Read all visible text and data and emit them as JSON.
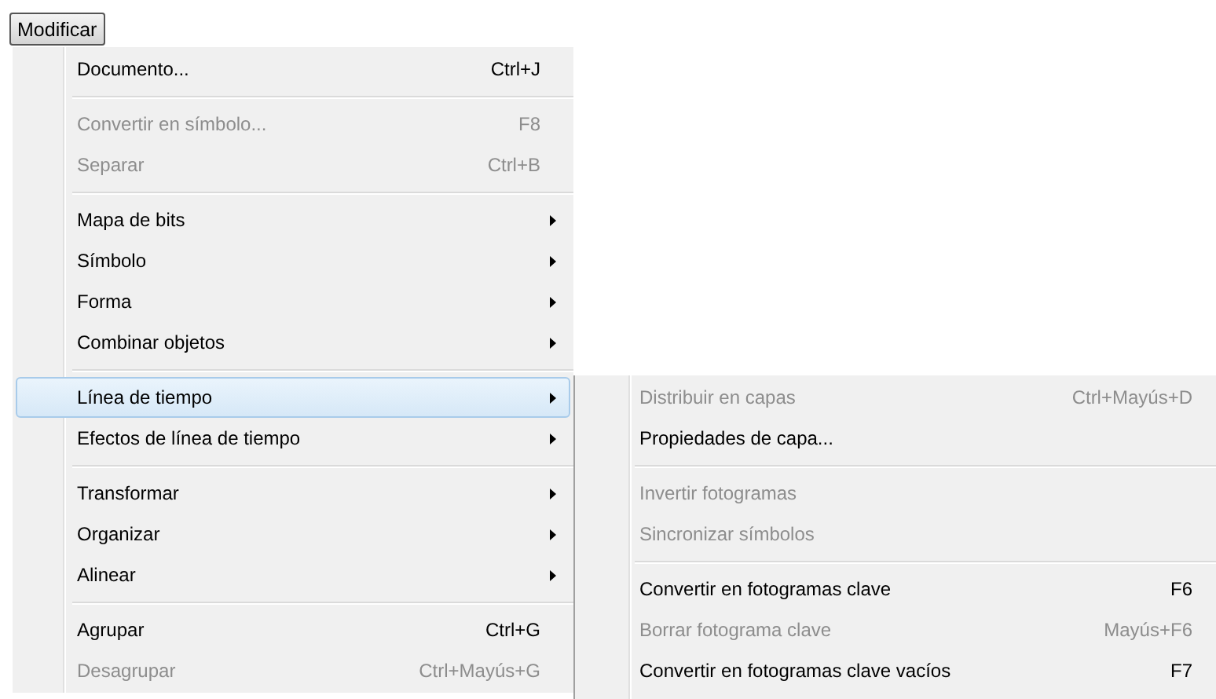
{
  "menu_button": {
    "label": "Modificar"
  },
  "menu": {
    "items": [
      {
        "kind": "item",
        "label": "Documento...",
        "shortcut": "Ctrl+J",
        "disabled": false,
        "has_submenu": false,
        "selected": false
      },
      {
        "kind": "separator"
      },
      {
        "kind": "item",
        "label": "Convertir en símbolo...",
        "shortcut": "F8",
        "disabled": true,
        "has_submenu": false,
        "selected": false
      },
      {
        "kind": "item",
        "label": "Separar",
        "shortcut": "Ctrl+B",
        "disabled": true,
        "has_submenu": false,
        "selected": false
      },
      {
        "kind": "separator"
      },
      {
        "kind": "item",
        "label": "Mapa de bits",
        "disabled": false,
        "has_submenu": true,
        "selected": false
      },
      {
        "kind": "item",
        "label": "Símbolo",
        "disabled": false,
        "has_submenu": true,
        "selected": false
      },
      {
        "kind": "item",
        "label": "Forma",
        "disabled": false,
        "has_submenu": true,
        "selected": false
      },
      {
        "kind": "item",
        "label": "Combinar objetos",
        "disabled": false,
        "has_submenu": true,
        "selected": false
      },
      {
        "kind": "separator"
      },
      {
        "kind": "item",
        "label": "Línea de tiempo",
        "disabled": false,
        "has_submenu": true,
        "selected": true
      },
      {
        "kind": "item",
        "label": "Efectos de línea de tiempo",
        "disabled": false,
        "has_submenu": true,
        "selected": false
      },
      {
        "kind": "separator"
      },
      {
        "kind": "item",
        "label": "Transformar",
        "disabled": false,
        "has_submenu": true,
        "selected": false
      },
      {
        "kind": "item",
        "label": "Organizar",
        "disabled": false,
        "has_submenu": true,
        "selected": false
      },
      {
        "kind": "item",
        "label": "Alinear",
        "disabled": false,
        "has_submenu": true,
        "selected": false
      },
      {
        "kind": "separator"
      },
      {
        "kind": "item",
        "label": "Agrupar",
        "shortcut": "Ctrl+G",
        "disabled": false,
        "has_submenu": false,
        "selected": false
      },
      {
        "kind": "item",
        "label": "Desagrupar",
        "shortcut": "Ctrl+Mayús+G",
        "disabled": true,
        "has_submenu": false,
        "selected": false
      }
    ]
  },
  "submenu": {
    "items": [
      {
        "kind": "item",
        "label": "Distribuir en capas",
        "shortcut": "Ctrl+Mayús+D",
        "disabled": true
      },
      {
        "kind": "item",
        "label": "Propiedades de capa...",
        "disabled": false
      },
      {
        "kind": "separator"
      },
      {
        "kind": "item",
        "label": "Invertir fotogramas",
        "disabled": true
      },
      {
        "kind": "item",
        "label": "Sincronizar símbolos",
        "disabled": true
      },
      {
        "kind": "separator"
      },
      {
        "kind": "item",
        "label": "Convertir en fotogramas clave",
        "shortcut": "F6",
        "disabled": false
      },
      {
        "kind": "item",
        "label": "Borrar fotograma clave",
        "shortcut": "Mayús+F6",
        "disabled": true
      },
      {
        "kind": "item",
        "label": "Convertir en fotogramas clave vacíos",
        "shortcut": "F7",
        "disabled": false
      }
    ]
  }
}
